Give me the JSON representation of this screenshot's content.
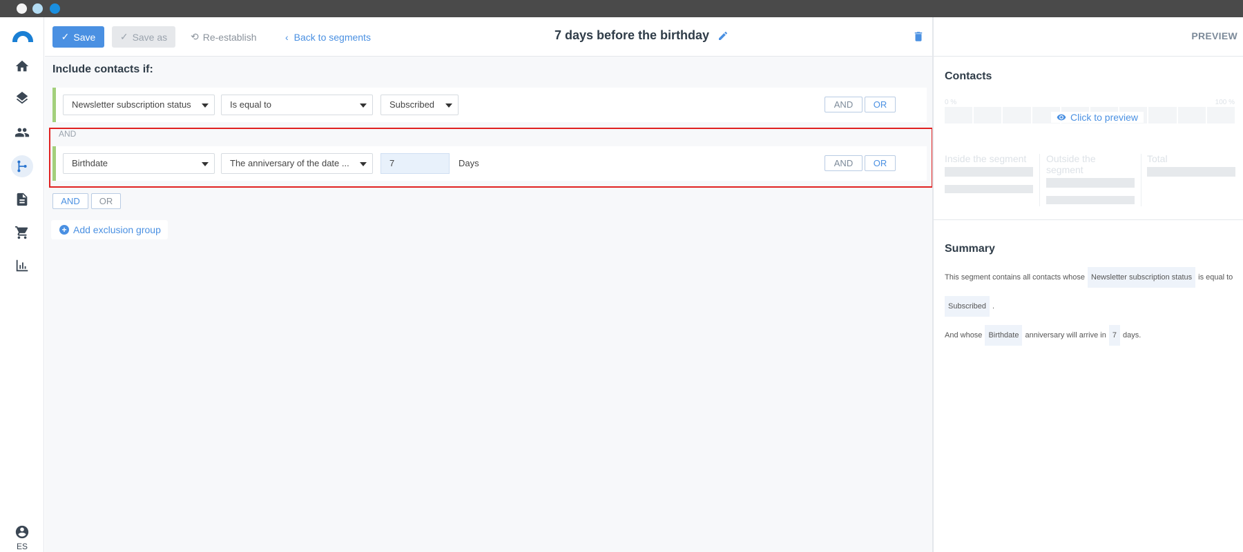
{
  "window": {
    "traffic_lights": [
      "close",
      "minimize",
      "maximize"
    ]
  },
  "nav": {
    "items": [
      {
        "icon": "home-icon",
        "active": false
      },
      {
        "icon": "layers-icon",
        "active": false
      },
      {
        "icon": "contacts-icon",
        "active": false
      },
      {
        "icon": "segments-icon",
        "active": true
      },
      {
        "icon": "document-icon",
        "active": false
      },
      {
        "icon": "cart-icon",
        "active": false
      },
      {
        "icon": "chart-icon",
        "active": false
      }
    ],
    "language": "ES"
  },
  "toolbar": {
    "save_label": "Save",
    "save_as_label": "Save as",
    "reestablish_label": "Re-establish",
    "back_label": "Back to segments",
    "segment_title": "7 days before the birthday"
  },
  "editor": {
    "include_label": "Include contacts if:",
    "conditions": [
      {
        "field": "Newsletter subscription status",
        "operator": "Is equal to",
        "value": "Subscribed"
      },
      {
        "field": "Birthdate",
        "operator": "The anniversary of the date will arrive in",
        "operator_display": "The anniversary of the date ...",
        "value": "7",
        "unit": "Days"
      }
    ],
    "separator": "AND",
    "and_label": "AND",
    "or_label": "OR",
    "add_exclusion_label": "Add exclusion group"
  },
  "preview": {
    "header": "PREVIEW",
    "contacts_heading": "Contacts",
    "scale_min": "0 %",
    "scale_max": "100 %",
    "click_to_preview": "Click to preview",
    "inside_label": "Inside the segment",
    "outside_label": "Outside the segment",
    "total_label": "Total",
    "summary_heading": "Summary",
    "summary": {
      "s1_prefix": "This segment contains all contacts whose",
      "s1_field": "Newsletter subscription status",
      "s1_middle": "is equal to",
      "s1_value": "Subscribed",
      "s1_end": ".",
      "s2_prefix": "And whose",
      "s2_field": "Birthdate",
      "s2_middle": "anniversary will arrive in",
      "s2_value": "7",
      "s2_end": "days."
    }
  },
  "colors": {
    "accent": "#4a90e2",
    "condition_bar": "#a3d07c",
    "highlight": "#e02020"
  }
}
